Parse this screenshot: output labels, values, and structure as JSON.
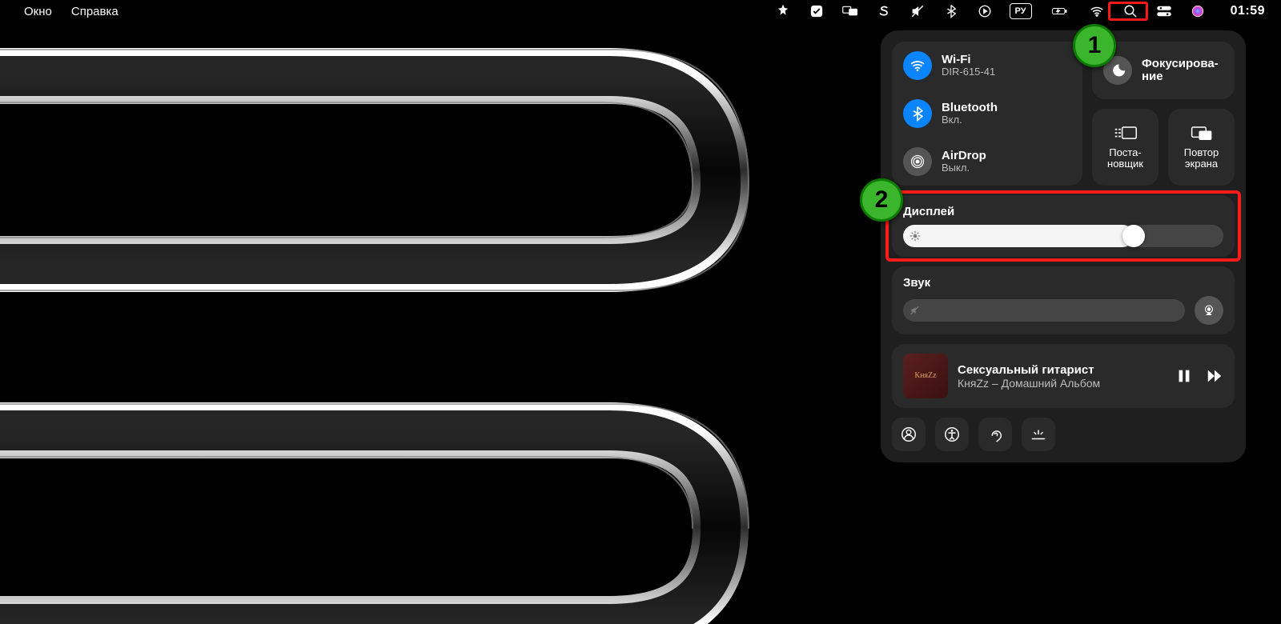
{
  "menubar": {
    "window_label": "Окно",
    "help_label": "Справка",
    "lang_code": "РУ",
    "time": "01:59"
  },
  "cc": {
    "wifi": {
      "title": "Wi-Fi",
      "sub": "DIR-615-41"
    },
    "bt": {
      "title": "Bluetooth",
      "sub": "Вкл."
    },
    "airdrop": {
      "title": "AirDrop",
      "sub": "Выкл."
    },
    "focus": {
      "title": "Фокусирова-\nние"
    },
    "stage": "Поста-\nновщик",
    "mirror": "Повтор\nэкрана",
    "display_label": "Дисплей",
    "display_pct": 72,
    "sound_label": "Звук",
    "sound_pct": 0,
    "np_title": "Сексуальный гитарист",
    "np_artist": "КняZz – Домашний Альбом",
    "np_art_text": "КняZz"
  },
  "annotations": {
    "b1": "1",
    "b2": "2"
  }
}
